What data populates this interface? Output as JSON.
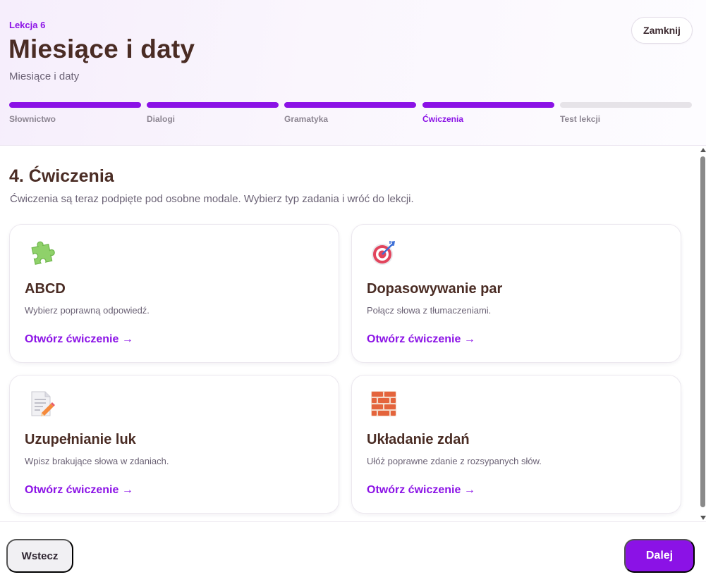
{
  "header": {
    "lesson_label": "Lekcja 6",
    "title": "Miesiące i daty",
    "subtitle": "Miesiące i daty",
    "close_label": "Zamknij"
  },
  "progress": {
    "steps": [
      {
        "label": "Słownictwo",
        "status": "done"
      },
      {
        "label": "Dialogi",
        "status": "done"
      },
      {
        "label": "Gramatyka",
        "status": "done"
      },
      {
        "label": "Ćwiczenia",
        "status": "current"
      },
      {
        "label": "Test lekcji",
        "status": "pending"
      }
    ]
  },
  "section": {
    "title": "4. Ćwiczenia",
    "description": "Ćwiczenia są teraz podpięte pod osobne modale. Wybierz typ zadania i wróć do lekcji."
  },
  "exercises": [
    {
      "icon": "puzzle-icon",
      "title": "ABCD",
      "description": "Wybierz poprawną odpowiedź.",
      "link": "Otwórz ćwiczenie →"
    },
    {
      "icon": "target-icon",
      "title": "Dopasowywanie par",
      "description": "Połącz słowa z tłumaczeniami.",
      "link": "Otwórz ćwiczenie →"
    },
    {
      "icon": "memo-icon",
      "title": "Uzupełnianie luk",
      "description": "Wpisz brakujące słowa w zdaniach.",
      "link": "Otwórz ćwiczenie →"
    },
    {
      "icon": "bricks-icon",
      "title": "Układanie zdań",
      "description": "Ułóż poprawne zdanie z rozsypanych słów.",
      "link": "Otwórz ćwiczenie →"
    }
  ],
  "footer": {
    "back_label": "Wstecz",
    "next_label": "Dalej"
  },
  "colors": {
    "accent": "#8b12e6",
    "title_text": "#4a2c24",
    "muted_text": "#6b6275",
    "progress_inactive": "#e6e3e8"
  }
}
